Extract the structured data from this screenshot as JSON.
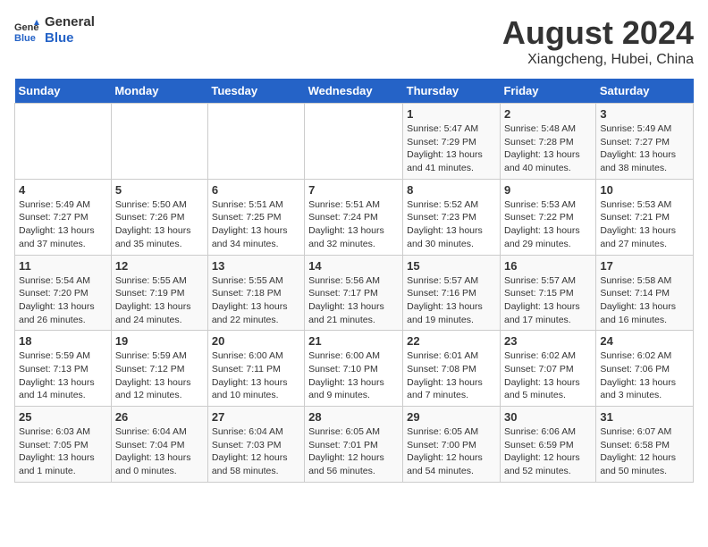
{
  "logo": {
    "line1": "General",
    "line2": "Blue"
  },
  "title": "August 2024",
  "subtitle": "Xiangcheng, Hubei, China",
  "days_of_week": [
    "Sunday",
    "Monday",
    "Tuesday",
    "Wednesday",
    "Thursday",
    "Friday",
    "Saturday"
  ],
  "weeks": [
    [
      {
        "day": "",
        "info": ""
      },
      {
        "day": "",
        "info": ""
      },
      {
        "day": "",
        "info": ""
      },
      {
        "day": "",
        "info": ""
      },
      {
        "day": "1",
        "info": "Sunrise: 5:47 AM\nSunset: 7:29 PM\nDaylight: 13 hours\nand 41 minutes."
      },
      {
        "day": "2",
        "info": "Sunrise: 5:48 AM\nSunset: 7:28 PM\nDaylight: 13 hours\nand 40 minutes."
      },
      {
        "day": "3",
        "info": "Sunrise: 5:49 AM\nSunset: 7:27 PM\nDaylight: 13 hours\nand 38 minutes."
      }
    ],
    [
      {
        "day": "4",
        "info": "Sunrise: 5:49 AM\nSunset: 7:27 PM\nDaylight: 13 hours\nand 37 minutes."
      },
      {
        "day": "5",
        "info": "Sunrise: 5:50 AM\nSunset: 7:26 PM\nDaylight: 13 hours\nand 35 minutes."
      },
      {
        "day": "6",
        "info": "Sunrise: 5:51 AM\nSunset: 7:25 PM\nDaylight: 13 hours\nand 34 minutes."
      },
      {
        "day": "7",
        "info": "Sunrise: 5:51 AM\nSunset: 7:24 PM\nDaylight: 13 hours\nand 32 minutes."
      },
      {
        "day": "8",
        "info": "Sunrise: 5:52 AM\nSunset: 7:23 PM\nDaylight: 13 hours\nand 30 minutes."
      },
      {
        "day": "9",
        "info": "Sunrise: 5:53 AM\nSunset: 7:22 PM\nDaylight: 13 hours\nand 29 minutes."
      },
      {
        "day": "10",
        "info": "Sunrise: 5:53 AM\nSunset: 7:21 PM\nDaylight: 13 hours\nand 27 minutes."
      }
    ],
    [
      {
        "day": "11",
        "info": "Sunrise: 5:54 AM\nSunset: 7:20 PM\nDaylight: 13 hours\nand 26 minutes."
      },
      {
        "day": "12",
        "info": "Sunrise: 5:55 AM\nSunset: 7:19 PM\nDaylight: 13 hours\nand 24 minutes."
      },
      {
        "day": "13",
        "info": "Sunrise: 5:55 AM\nSunset: 7:18 PM\nDaylight: 13 hours\nand 22 minutes."
      },
      {
        "day": "14",
        "info": "Sunrise: 5:56 AM\nSunset: 7:17 PM\nDaylight: 13 hours\nand 21 minutes."
      },
      {
        "day": "15",
        "info": "Sunrise: 5:57 AM\nSunset: 7:16 PM\nDaylight: 13 hours\nand 19 minutes."
      },
      {
        "day": "16",
        "info": "Sunrise: 5:57 AM\nSunset: 7:15 PM\nDaylight: 13 hours\nand 17 minutes."
      },
      {
        "day": "17",
        "info": "Sunrise: 5:58 AM\nSunset: 7:14 PM\nDaylight: 13 hours\nand 16 minutes."
      }
    ],
    [
      {
        "day": "18",
        "info": "Sunrise: 5:59 AM\nSunset: 7:13 PM\nDaylight: 13 hours\nand 14 minutes."
      },
      {
        "day": "19",
        "info": "Sunrise: 5:59 AM\nSunset: 7:12 PM\nDaylight: 13 hours\nand 12 minutes."
      },
      {
        "day": "20",
        "info": "Sunrise: 6:00 AM\nSunset: 7:11 PM\nDaylight: 13 hours\nand 10 minutes."
      },
      {
        "day": "21",
        "info": "Sunrise: 6:00 AM\nSunset: 7:10 PM\nDaylight: 13 hours\nand 9 minutes."
      },
      {
        "day": "22",
        "info": "Sunrise: 6:01 AM\nSunset: 7:08 PM\nDaylight: 13 hours\nand 7 minutes."
      },
      {
        "day": "23",
        "info": "Sunrise: 6:02 AM\nSunset: 7:07 PM\nDaylight: 13 hours\nand 5 minutes."
      },
      {
        "day": "24",
        "info": "Sunrise: 6:02 AM\nSunset: 7:06 PM\nDaylight: 13 hours\nand 3 minutes."
      }
    ],
    [
      {
        "day": "25",
        "info": "Sunrise: 6:03 AM\nSunset: 7:05 PM\nDaylight: 13 hours\nand 1 minute."
      },
      {
        "day": "26",
        "info": "Sunrise: 6:04 AM\nSunset: 7:04 PM\nDaylight: 13 hours\nand 0 minutes."
      },
      {
        "day": "27",
        "info": "Sunrise: 6:04 AM\nSunset: 7:03 PM\nDaylight: 12 hours\nand 58 minutes."
      },
      {
        "day": "28",
        "info": "Sunrise: 6:05 AM\nSunset: 7:01 PM\nDaylight: 12 hours\nand 56 minutes."
      },
      {
        "day": "29",
        "info": "Sunrise: 6:05 AM\nSunset: 7:00 PM\nDaylight: 12 hours\nand 54 minutes."
      },
      {
        "day": "30",
        "info": "Sunrise: 6:06 AM\nSunset: 6:59 PM\nDaylight: 12 hours\nand 52 minutes."
      },
      {
        "day": "31",
        "info": "Sunrise: 6:07 AM\nSunset: 6:58 PM\nDaylight: 12 hours\nand 50 minutes."
      }
    ]
  ]
}
